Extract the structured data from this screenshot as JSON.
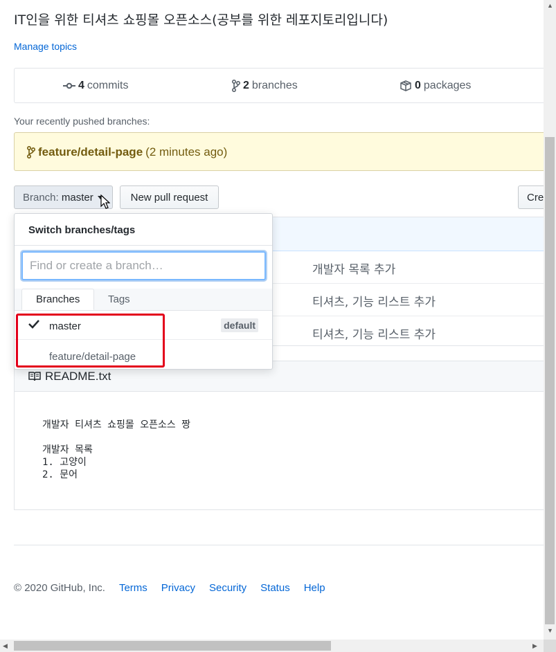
{
  "repo": {
    "description": "IT인을 위한 티셔츠 쇼핑몰 오픈소스(공부를 위한 레포지토리입니다)",
    "manage_topics": "Manage topics"
  },
  "numbers": {
    "commits_count": "4",
    "commits_label": "commits",
    "branches_count": "2",
    "branches_label": "branches",
    "packages_count": "0",
    "packages_label": "packages"
  },
  "recent": {
    "label": "Your recently pushed branches:",
    "branch": "feature/detail-page",
    "time": "(2 minutes ago)"
  },
  "toolbar": {
    "branch_prefix": "Branch:",
    "branch_name": "master",
    "new_pr": "New pull request",
    "create": "Cre"
  },
  "files": {
    "messages": [
      "개발자 목록 추가",
      "티셔츠, 기능 리스트 추가",
      "티셔츠, 기능 리스트 추가"
    ]
  },
  "readme": {
    "title": "README.txt",
    "content": "개발자 티셔츠 쇼핑몰 오픈소스 짱\n\n개발자 목록\n1. 고양이\n2. 문어"
  },
  "dropdown": {
    "title": "Switch branches/tags",
    "placeholder": "Find or create a branch…",
    "tab_branches": "Branches",
    "tab_tags": "Tags",
    "branches": [
      {
        "name": "master",
        "badge": "default",
        "selected": true
      },
      {
        "name": "feature/detail-page"
      }
    ]
  },
  "footer": {
    "copyright": "© 2020 GitHub, Inc.",
    "links": [
      "Terms",
      "Privacy",
      "Security",
      "Status",
      "Help"
    ]
  },
  "colors": {
    "link": "#0366d6",
    "highlight": "#e3001b",
    "recent_bg": "#fffbdd"
  }
}
